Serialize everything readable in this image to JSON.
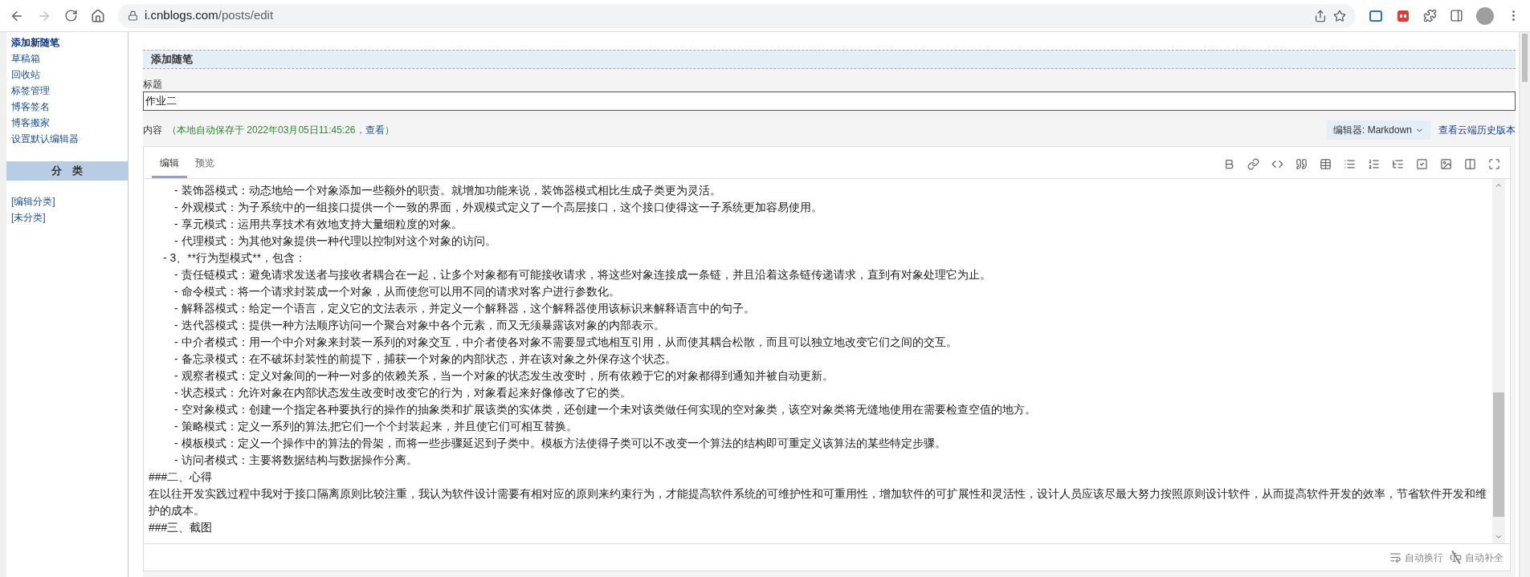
{
  "browser": {
    "url_host": "i.cnblogs.com",
    "url_path": "/posts/edit"
  },
  "sidebar": {
    "items": [
      {
        "label": "添加新随笔",
        "selected": true
      },
      {
        "label": "草稿箱",
        "selected": false
      },
      {
        "label": "回收站",
        "selected": false
      },
      {
        "label": "标签管理",
        "selected": false
      },
      {
        "label": "博客签名",
        "selected": false
      },
      {
        "label": "博客搬家",
        "selected": false
      },
      {
        "label": "设置默认编辑器",
        "selected": false
      }
    ],
    "category_header": "分　类",
    "category_links": [
      "[编辑分类]",
      "[未分类]"
    ]
  },
  "panel": {
    "title": "添加随笔",
    "title_label": "标题",
    "title_value": "作业二",
    "content_label": "内容",
    "autosave_note": "（本地自动保存于 2022年03月05日11:45:26，",
    "autosave_link": "查看",
    "autosave_end": "）",
    "editor_select": "编辑器: Markdown",
    "history_link": "查看云端历史版本"
  },
  "editor": {
    "tabs": [
      {
        "label": "编辑",
        "selected": true
      },
      {
        "label": "预览",
        "selected": false
      }
    ],
    "lines": [
      {
        "kind": "sub",
        "text": "- 装饰器模式：动态地给一个对象添加一些额外的职责。就增加功能来说，装饰器模式相比生成子类更为灵活。"
      },
      {
        "kind": "sub",
        "text": "- 外观模式：为子系统中的一组接口提供一个一致的界面，外观模式定义了一个高层接口，这个接口使得这一子系统更加容易使用。"
      },
      {
        "kind": "sub",
        "text": "- 享元模式：运用共享技术有效地支持大量细粒度的对象。"
      },
      {
        "kind": "sub",
        "text": "- 代理模式：为其他对象提供一种代理以控制对这个对象的访问。"
      },
      {
        "kind": "item",
        "text": "- 3、**行为型模式**，包含："
      },
      {
        "kind": "sub",
        "text": "- 责任链模式：避免请求发送者与接收者耦合在一起，让多个对象都有可能接收请求，将这些对象连接成一条链，并且沿着这条链传递请求，直到有对象处理它为止。"
      },
      {
        "kind": "sub",
        "text": "- 命令模式：将一个请求封装成一个对象，从而使您可以用不同的请求对客户进行参数化。"
      },
      {
        "kind": "sub",
        "text": "- 解释器模式：给定一个语言，定义它的文法表示，并定义一个解释器，这个解释器使用该标识来解释语言中的句子。"
      },
      {
        "kind": "sub",
        "text": "- 迭代器模式：提供一种方法顺序访问一个聚合对象中各个元素，而又无须暴露该对象的内部表示。"
      },
      {
        "kind": "sub",
        "text": "- 中介者模式：用一个中介对象来封装一系列的对象交互，中介者使各对象不需要显式地相互引用，从而使其耦合松散，而且可以独立地改变它们之间的交互。"
      },
      {
        "kind": "sub",
        "text": "- 备忘录模式：在不破坏封装性的前提下，捕获一个对象的内部状态，并在该对象之外保存这个状态。"
      },
      {
        "kind": "sub",
        "text": "- 观察者模式：定义对象间的一种一对多的依赖关系，当一个对象的状态发生改变时，所有依赖于它的对象都得到通知并被自动更新。"
      },
      {
        "kind": "sub",
        "text": "- 状态模式：允许对象在内部状态发生改变时改变它的行为，对象看起来好像修改了它的类。"
      },
      {
        "kind": "sub",
        "text": "- 空对象模式：创建一个指定各种要执行的操作的抽象类和扩展该类的实体类，还创建一个未对该类做任何实现的空对象类，该空对象类将无缝地使用在需要检查空值的地方。"
      },
      {
        "kind": "sub",
        "text": "- 策略模式：定义一系列的算法,把它们一个个封装起来，并且使它们可相互替换。"
      },
      {
        "kind": "sub",
        "text": "- 模板模式：定义一个操作中的算法的骨架，而将一些步骤延迟到子类中。模板方法使得子类可以不改变一个算法的结构即可重定义该算法的某些特定步骤。"
      },
      {
        "kind": "sub",
        "text": "- 访问者模式：主要将数据结构与数据操作分离。"
      },
      {
        "kind": "text",
        "text": "###二、心得"
      },
      {
        "kind": "text",
        "text": "在以往开发实践过程中我对于接口隔离原则比较注重，我认为软件设计需要有相对应的原则来约束行为，才能提高软件系统的可维护性和可重用性，增加软件的可扩展性和灵活性，设计人员应该尽最大努力按照原则设计软件，从而提高软件开发的效率，节省软件开发和维护的成本。"
      },
      {
        "kind": "text",
        "text": "###三、截图"
      }
    ],
    "footer": [
      {
        "kind": "wrap",
        "label": "自动换行",
        "on": true
      },
      {
        "kind": "complete",
        "label": "自动补全",
        "on": false
      }
    ]
  }
}
